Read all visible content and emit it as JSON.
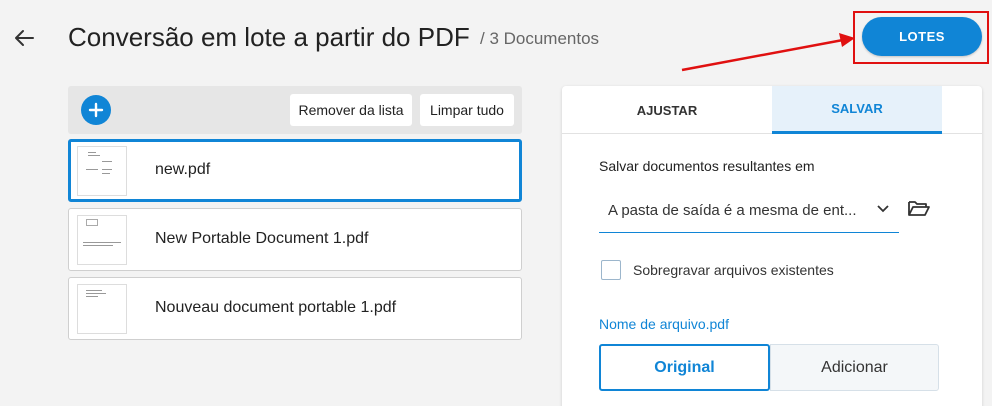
{
  "header": {
    "title": "Conversão em lote a partir do PDF",
    "count": "/ 3 Documentos",
    "lotes_label": "LOTES",
    "accent_color": "#1085d6",
    "highlight_color": "#e01010"
  },
  "toolbar": {
    "remove_label": "Remover da lista",
    "clear_label": "Limpar tudo"
  },
  "files": [
    {
      "name": "new.pdf",
      "selected": true
    },
    {
      "name": "New Portable Document 1.pdf",
      "selected": false
    },
    {
      "name": "Nouveau document portable 1.pdf",
      "selected": false
    }
  ],
  "panel": {
    "tabs": [
      {
        "label": "AJUSTAR",
        "active": false
      },
      {
        "label": "SALVAR",
        "active": true
      }
    ],
    "save_label": "Salvar documentos resultantes em",
    "save_location": "A pasta de saída é a mesma de ent...",
    "overwrite_label": "Sobregravar arquivos existentes",
    "overwrite_checked": false,
    "filename_label": "Nome de arquivo.pdf",
    "filename_options": [
      "Original",
      "Adicionar"
    ],
    "filename_selected": "Original"
  }
}
